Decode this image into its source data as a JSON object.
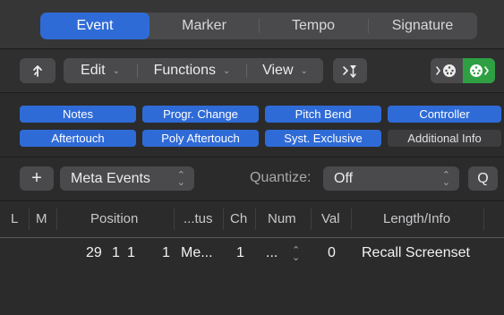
{
  "tabs": [
    {
      "label": "Event",
      "active": true
    },
    {
      "label": "Marker",
      "active": false
    },
    {
      "label": "Tempo",
      "active": false
    },
    {
      "label": "Signature",
      "active": false
    }
  ],
  "toolbar": {
    "up_icon": "arrow-up-from-branch-icon",
    "edit_label": "Edit",
    "functions_label": "Functions",
    "view_label": "View",
    "filter_icon": "midi-out-filter-icon",
    "midi_in_icon": "midi-in-icon",
    "midi_out_icon": "midi-out-icon",
    "midi_out_active_color": "#2ea043"
  },
  "filters": {
    "row1": [
      "Notes",
      "Progr. Change",
      "Pitch Bend",
      "Controller"
    ],
    "row2": [
      "Aftertouch",
      "Poly Aftertouch",
      "Syst. Exclusive",
      "Additional Info"
    ],
    "row2_active": [
      true,
      true,
      true,
      false
    ],
    "accent_color": "#2f6bd7"
  },
  "meta": {
    "add_label": "+",
    "meta_events_label": "Meta Events",
    "quantize_label": "Quantize:",
    "quantize_value": "Off",
    "q_label": "Q"
  },
  "table": {
    "headers": {
      "l": "L",
      "m": "M",
      "position": "Position",
      "status": "...tus",
      "ch": "Ch",
      "num": "Num",
      "val": "Val",
      "length": "Length/Info"
    },
    "rows": [
      {
        "pos_bar": "29",
        "pos_beat": "1",
        "pos_div": "1",
        "pos_tick": "1",
        "status": "Me...",
        "ch": "1",
        "num": "...",
        "val": "0",
        "length": "Recall Screenset"
      }
    ]
  }
}
